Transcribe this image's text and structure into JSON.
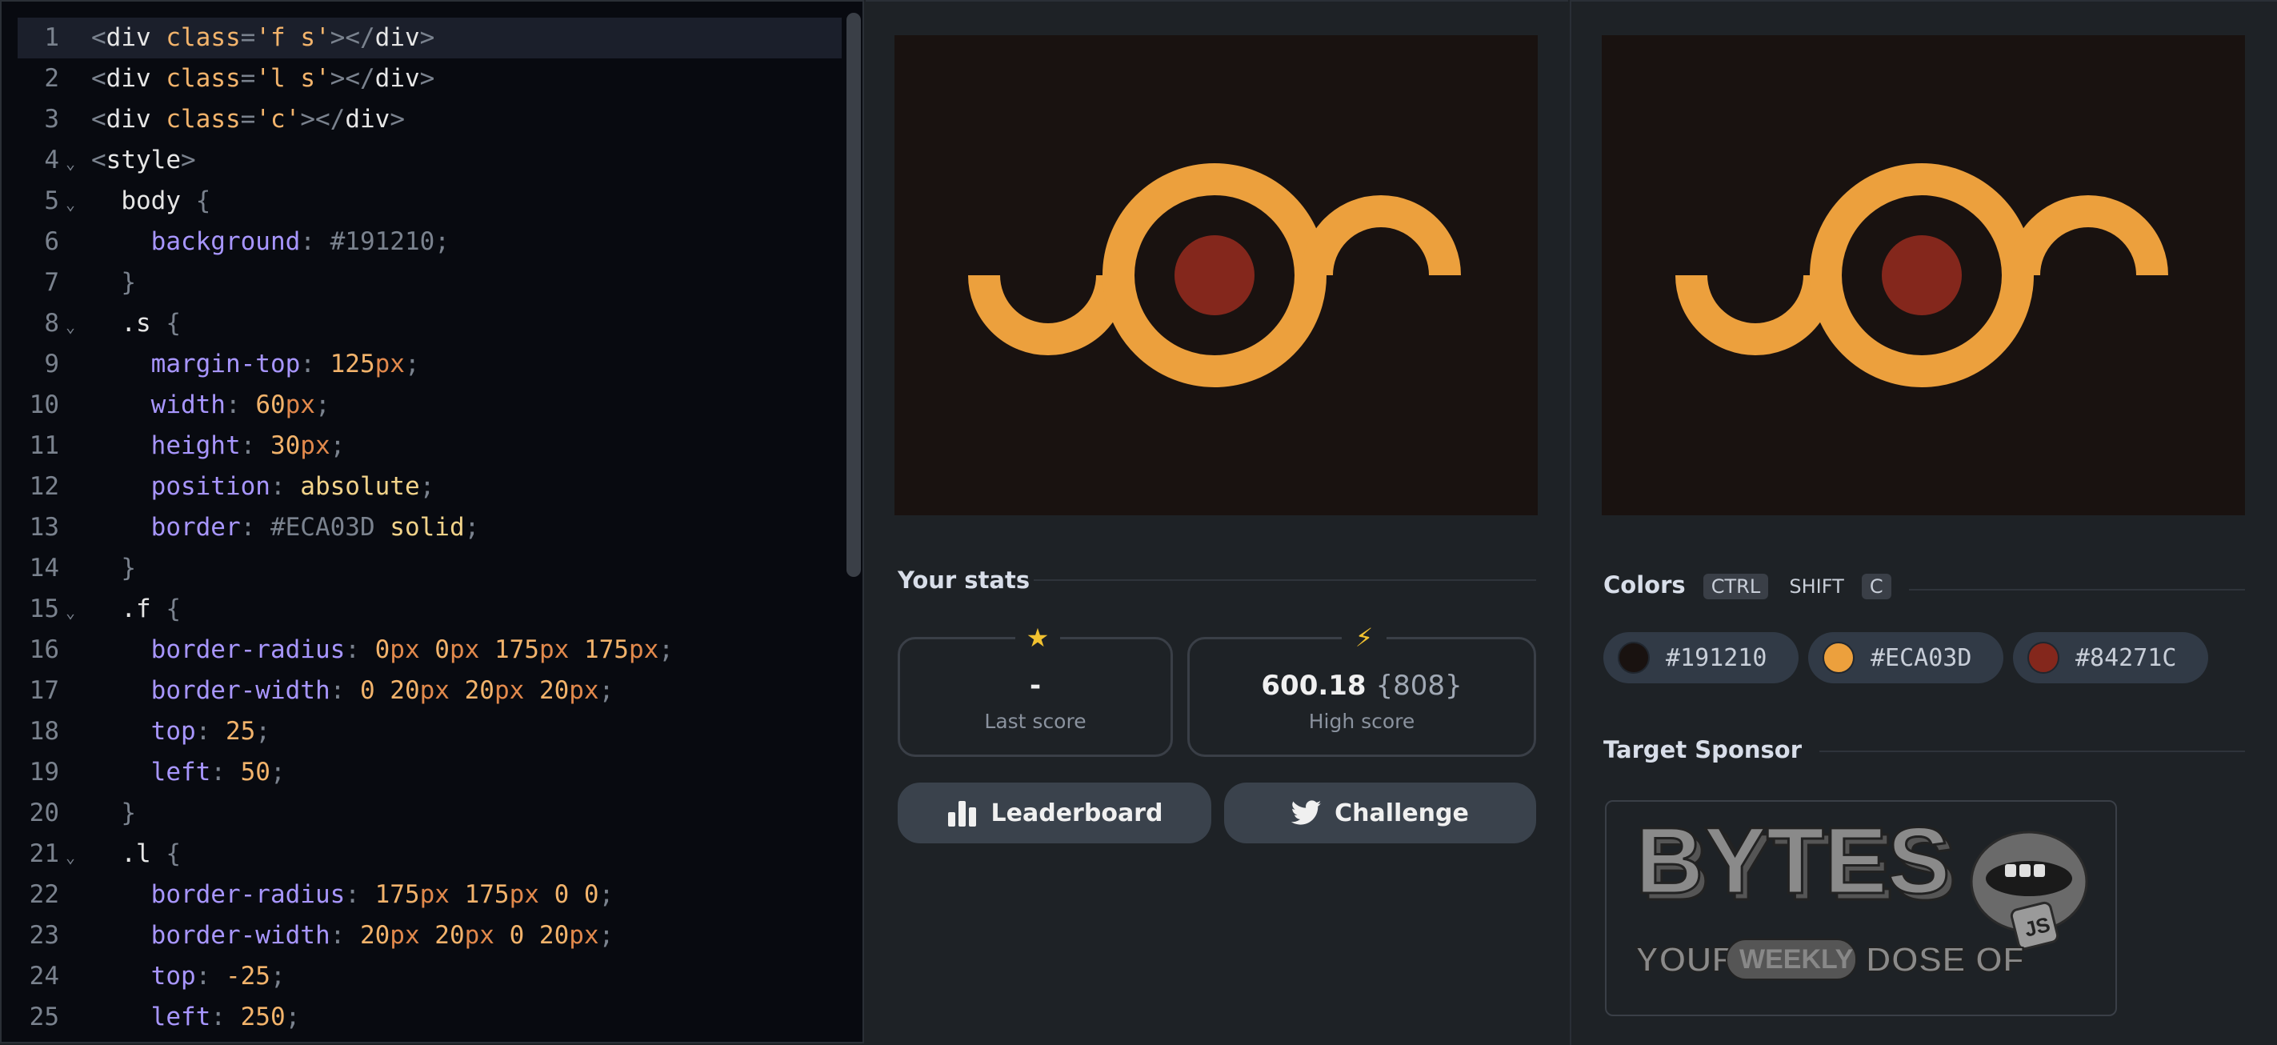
{
  "editor": {
    "lines": [
      {
        "n": "1",
        "active": true,
        "fold": false,
        "tokens": [
          [
            "c-punct",
            "<"
          ],
          [
            "c-tag",
            "div"
          ],
          [
            "c-attr",
            " class"
          ],
          [
            "c-punct",
            "="
          ],
          [
            "c-str",
            "'f s'"
          ],
          [
            "c-punct",
            "></"
          ],
          [
            "c-tag",
            "div"
          ],
          [
            "c-punct",
            ">"
          ]
        ]
      },
      {
        "n": "2",
        "fold": false,
        "tokens": [
          [
            "c-punct",
            "<"
          ],
          [
            "c-tag",
            "div"
          ],
          [
            "c-attr",
            " class"
          ],
          [
            "c-punct",
            "="
          ],
          [
            "c-str",
            "'l s'"
          ],
          [
            "c-punct",
            "></"
          ],
          [
            "c-tag",
            "div"
          ],
          [
            "c-punct",
            ">"
          ]
        ]
      },
      {
        "n": "3",
        "fold": false,
        "tokens": [
          [
            "c-punct",
            "<"
          ],
          [
            "c-tag",
            "div"
          ],
          [
            "c-attr",
            " class"
          ],
          [
            "c-punct",
            "="
          ],
          [
            "c-str",
            "'c'"
          ],
          [
            "c-punct",
            "></"
          ],
          [
            "c-tag",
            "div"
          ],
          [
            "c-punct",
            ">"
          ]
        ]
      },
      {
        "n": "4",
        "fold": true,
        "tokens": [
          [
            "c-punct",
            "<"
          ],
          [
            "c-tag",
            "style"
          ],
          [
            "c-punct",
            ">"
          ]
        ]
      },
      {
        "n": "5",
        "fold": true,
        "tokens": [
          [
            "c-sel",
            "  body "
          ],
          [
            "c-punct",
            "{"
          ]
        ]
      },
      {
        "n": "6",
        "fold": false,
        "tokens": [
          [
            "c-prop",
            "    background"
          ],
          [
            "c-punct",
            ": "
          ],
          [
            "c-hex",
            "#191210"
          ],
          [
            "c-punct",
            ";"
          ]
        ]
      },
      {
        "n": "7",
        "fold": false,
        "tokens": [
          [
            "c-punct",
            "  }"
          ]
        ]
      },
      {
        "n": "8",
        "fold": true,
        "tokens": [
          [
            "c-sel",
            "  .s "
          ],
          [
            "c-punct",
            "{"
          ]
        ]
      },
      {
        "n": "9",
        "fold": false,
        "tokens": [
          [
            "c-prop",
            "    margin-top"
          ],
          [
            "c-punct",
            ": "
          ],
          [
            "c-num",
            "125"
          ],
          [
            "c-unit",
            "px"
          ],
          [
            "c-punct",
            ";"
          ]
        ]
      },
      {
        "n": "10",
        "fold": false,
        "tokens": [
          [
            "c-prop",
            "    width"
          ],
          [
            "c-punct",
            ": "
          ],
          [
            "c-num",
            "60"
          ],
          [
            "c-unit",
            "px"
          ],
          [
            "c-punct",
            ";"
          ]
        ]
      },
      {
        "n": "11",
        "fold": false,
        "tokens": [
          [
            "c-prop",
            "    height"
          ],
          [
            "c-punct",
            ": "
          ],
          [
            "c-num",
            "30"
          ],
          [
            "c-unit",
            "px"
          ],
          [
            "c-punct",
            ";"
          ]
        ]
      },
      {
        "n": "12",
        "fold": false,
        "tokens": [
          [
            "c-prop",
            "    position"
          ],
          [
            "c-punct",
            ": "
          ],
          [
            "c-val",
            "absolute"
          ],
          [
            "c-punct",
            ";"
          ]
        ]
      },
      {
        "n": "13",
        "fold": false,
        "tokens": [
          [
            "c-prop",
            "    border"
          ],
          [
            "c-punct",
            ": "
          ],
          [
            "c-hex",
            "#ECA03D"
          ],
          [
            "c-val",
            " solid"
          ],
          [
            "c-punct",
            ";"
          ]
        ]
      },
      {
        "n": "14",
        "fold": false,
        "tokens": [
          [
            "c-punct",
            "  }"
          ]
        ]
      },
      {
        "n": "15",
        "fold": true,
        "tokens": [
          [
            "c-sel",
            "  .f "
          ],
          [
            "c-punct",
            "{"
          ]
        ]
      },
      {
        "n": "16",
        "fold": false,
        "tokens": [
          [
            "c-prop",
            "    border-radius"
          ],
          [
            "c-punct",
            ": "
          ],
          [
            "c-num",
            "0"
          ],
          [
            "c-unit",
            "px "
          ],
          [
            "c-num",
            "0"
          ],
          [
            "c-unit",
            "px "
          ],
          [
            "c-num",
            "175"
          ],
          [
            "c-unit",
            "px "
          ],
          [
            "c-num",
            "175"
          ],
          [
            "c-unit",
            "px"
          ],
          [
            "c-punct",
            ";"
          ]
        ]
      },
      {
        "n": "17",
        "fold": false,
        "tokens": [
          [
            "c-prop",
            "    border-width"
          ],
          [
            "c-punct",
            ": "
          ],
          [
            "c-num",
            "0 20"
          ],
          [
            "c-unit",
            "px "
          ],
          [
            "c-num",
            "20"
          ],
          [
            "c-unit",
            "px "
          ],
          [
            "c-num",
            "20"
          ],
          [
            "c-unit",
            "px"
          ],
          [
            "c-punct",
            ";"
          ]
        ]
      },
      {
        "n": "18",
        "fold": false,
        "tokens": [
          [
            "c-prop",
            "    top"
          ],
          [
            "c-punct",
            ": "
          ],
          [
            "c-num",
            "25"
          ],
          [
            "c-punct",
            ";"
          ]
        ]
      },
      {
        "n": "19",
        "fold": false,
        "tokens": [
          [
            "c-prop",
            "    left"
          ],
          [
            "c-punct",
            ": "
          ],
          [
            "c-num",
            "50"
          ],
          [
            "c-punct",
            ";"
          ]
        ]
      },
      {
        "n": "20",
        "fold": false,
        "tokens": [
          [
            "c-punct",
            "  }"
          ]
        ]
      },
      {
        "n": "21",
        "fold": true,
        "tokens": [
          [
            "c-sel",
            "  .l "
          ],
          [
            "c-punct",
            "{"
          ]
        ]
      },
      {
        "n": "22",
        "fold": false,
        "tokens": [
          [
            "c-prop",
            "    border-radius"
          ],
          [
            "c-punct",
            ": "
          ],
          [
            "c-num",
            "175"
          ],
          [
            "c-unit",
            "px "
          ],
          [
            "c-num",
            "175"
          ],
          [
            "c-unit",
            "px "
          ],
          [
            "c-num",
            "0 0"
          ],
          [
            "c-punct",
            ";"
          ]
        ]
      },
      {
        "n": "23",
        "fold": false,
        "tokens": [
          [
            "c-prop",
            "    border-width"
          ],
          [
            "c-punct",
            ": "
          ],
          [
            "c-num",
            "20"
          ],
          [
            "c-unit",
            "px "
          ],
          [
            "c-num",
            "20"
          ],
          [
            "c-unit",
            "px "
          ],
          [
            "c-num",
            "0 20"
          ],
          [
            "c-unit",
            "px"
          ],
          [
            "c-punct",
            ";"
          ]
        ]
      },
      {
        "n": "24",
        "fold": false,
        "tokens": [
          [
            "c-prop",
            "    top"
          ],
          [
            "c-punct",
            ": "
          ],
          [
            "c-num",
            "-25"
          ],
          [
            "c-punct",
            ";"
          ]
        ]
      },
      {
        "n": "25",
        "fold": false,
        "tokens": [
          [
            "c-prop",
            "    left"
          ],
          [
            "c-punct",
            ": "
          ],
          [
            "c-num",
            "250"
          ],
          [
            "c-punct",
            ";"
          ]
        ]
      }
    ]
  },
  "colors_palette": {
    "bg": "#191210",
    "orange": "#ECA03D",
    "red": "#84271C"
  },
  "stats": {
    "title": "Your stats",
    "last_score_icon": "star-icon",
    "last_score_value": "-",
    "last_score_label": "Last score",
    "high_score_icon": "lightning-icon",
    "high_score_value": "600.18",
    "high_score_chars": "{808}",
    "high_score_label": "High score"
  },
  "buttons": {
    "leaderboard": "Leaderboard",
    "challenge": "Challenge"
  },
  "colors": {
    "title": "Colors",
    "kbd_ctrl": "CTRL",
    "kbd_shift": "SHIFT",
    "kbd_c": "C",
    "chips": [
      {
        "hex": "#191210",
        "label": "#191210"
      },
      {
        "hex": "#ECA03D",
        "label": "#ECA03D"
      },
      {
        "hex": "#84271C",
        "label": "#84271C"
      }
    ]
  },
  "sponsor": {
    "title": "Target Sponsor",
    "brand": "BYTES",
    "tagline_1": "YOUR",
    "tagline_2": "WEEKLY",
    "tagline_3": "DOSE OF",
    "badge": "JS"
  }
}
